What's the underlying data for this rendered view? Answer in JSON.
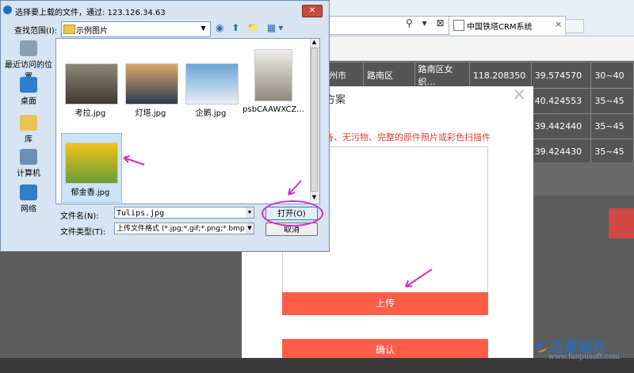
{
  "browser": {
    "tab_title": "中国铁塔CRM系统",
    "tab_close": "×",
    "addr_icons": "⚲ ▾ ⊠ ↻"
  },
  "bg_table": {
    "rows": [
      [
        "州市",
        "路南区",
        "路南区女织…",
        "118.208350",
        "39.574570",
        "30~40"
      ],
      [
        "",
        "",
        "",
        "",
        "40.424553",
        "35~45"
      ],
      [
        "",
        "",
        "",
        "",
        "39.442440",
        "35~45"
      ],
      [
        "",
        "",
        "",
        "",
        "39.424430",
        "35~45"
      ]
    ]
  },
  "upload_modal": {
    "close": "×",
    "title_fragment": "方案",
    "dash_fragment": "-",
    "notice": "备、无污物、完整的原件照片或彩色扫描件",
    "upload_label": "上传",
    "confirm_label": "确认"
  },
  "dialog": {
    "title": "选择要上载的文件，通过: 123.126.34.63",
    "close": "✕",
    "lookin_label": "查找范围(I):",
    "lookin_value": "示例图片",
    "places": [
      {
        "label": "最近访问的位置",
        "icon": "recent-places-icon",
        "color": "#8a9fb5"
      },
      {
        "label": "桌面",
        "icon": "desktop-icon",
        "color": "#2c7fcf"
      },
      {
        "label": "库",
        "icon": "library-icon",
        "color": "#e7c458"
      },
      {
        "label": "计算机",
        "icon": "computer-icon",
        "color": "#6b8fb7"
      },
      {
        "label": "网络",
        "icon": "network-icon",
        "color": "#2f7ec6"
      }
    ],
    "files": [
      {
        "name": "考拉.jpg",
        "icon": "koala-thumbnail",
        "colors": [
          "#8d8778",
          "#3f3a30"
        ]
      },
      {
        "name": "灯塔.jpg",
        "icon": "lighthouse-thumbnail",
        "colors": [
          "#d9a86a",
          "#2e3a52"
        ]
      },
      {
        "name": "企鹅.jpg",
        "icon": "penguins-thumbnail",
        "colors": [
          "#6aa5d8",
          "#e9eef5"
        ]
      },
      {
        "name": "psbCAAWXCZ...",
        "icon": "statue-thumbnail",
        "colors": [
          "#eeeeea",
          "#8f8a7d"
        ]
      },
      {
        "name": "郁金香.jpg",
        "icon": "tulips-thumbnail",
        "colors": [
          "#f0c318",
          "#6a9e3a"
        ]
      }
    ],
    "filename_label": "文件名(N):",
    "filename_value": "Tulips.jpg",
    "filetype_label": "文件类型(T):",
    "filetype_value": "上传文件格式 (*.jpg;*.gif;*.png;*.bmp",
    "open_label": "打开(O)",
    "cancel_label": "取消"
  },
  "logo": {
    "text": "泛普软件",
    "url": "www.fanpusoft.com"
  },
  "colors": {
    "accent_button": "#fd5d46",
    "annotation_arrow": "#d42ecb",
    "notice_text": "#e03c31"
  }
}
